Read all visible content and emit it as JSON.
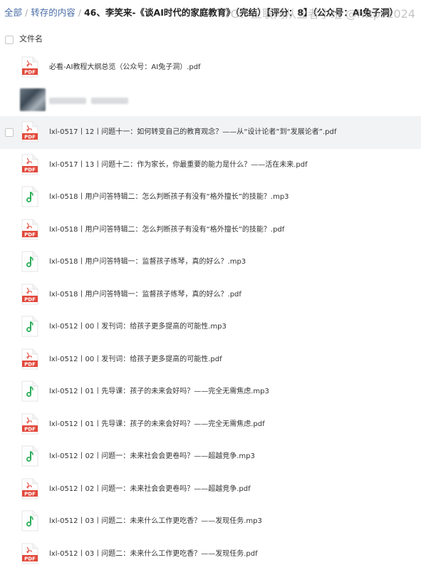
{
  "breadcrumb": {
    "root": "全部",
    "parent": "转存的内容",
    "current": "46、李笑来-《谈AI时代的家庭教育》（完结）【评分：8】（公众号：AI兔子洞）"
  },
  "watermark": "TG：三联网从业者小组 @https1024",
  "header": {
    "column_filename": "文件名"
  },
  "icons": {
    "pdf_label": "PDF",
    "pdf_color": "#e2483b",
    "audio_color": "#2fae5c"
  },
  "files": [
    {
      "type": "pdf",
      "name": "必看-AI教程大纲总览（公众号：AI兔子洞）.pdf"
    },
    {
      "type": "blurred",
      "name": ""
    },
    {
      "type": "pdf",
      "name": "lxl-0517丨12丨问题十一：如何转变自己的教育观念？——从“设计论者”到“发展论者”.pdf",
      "hover": true
    },
    {
      "type": "pdf",
      "name": "lxl-0517丨13丨问题十二：作为家长，你最重要的能力是什么？——活在未来.pdf"
    },
    {
      "type": "audio",
      "name": "lxl-0518丨用户问答特辑二：怎么判断孩子有没有“格外擅长”的技能？.mp3"
    },
    {
      "type": "pdf",
      "name": "lxl-0518丨用户问答特辑二：怎么判断孩子有没有“格外擅长”的技能？.pdf"
    },
    {
      "type": "audio",
      "name": "lxl-0518丨用户问答特辑一：监督孩子练琴，真的好么？.mp3"
    },
    {
      "type": "pdf",
      "name": "lxl-0518丨用户问答特辑一：监督孩子练琴，真的好么？.pdf"
    },
    {
      "type": "audio",
      "name": "lxl-0512丨00丨发刊词：给孩子更多提高的可能性.mp3"
    },
    {
      "type": "pdf",
      "name": "lxl-0512丨00丨发刊词：给孩子更多提高的可能性.pdf"
    },
    {
      "type": "audio",
      "name": "lxl-0512丨01丨先导课：孩子的未来会好吗？——完全无需焦虑.mp3"
    },
    {
      "type": "pdf",
      "name": "lxl-0512丨01丨先导课：孩子的未来会好吗？——完全无需焦虑.pdf"
    },
    {
      "type": "audio",
      "name": "lxl-0512丨02丨问题一：未来社会会更卷吗？——超越竞争.mp3"
    },
    {
      "type": "pdf",
      "name": "lxl-0512丨02丨问题一：未来社会会更卷吗？——超越竞争.pdf"
    },
    {
      "type": "audio",
      "name": "lxl-0512丨03丨问题二：未来什么工作更吃香？——发现任务.mp3"
    },
    {
      "type": "pdf",
      "name": "lxl-0512丨03丨问题二：未来什么工作更吃香？——发现任务.pdf"
    }
  ]
}
